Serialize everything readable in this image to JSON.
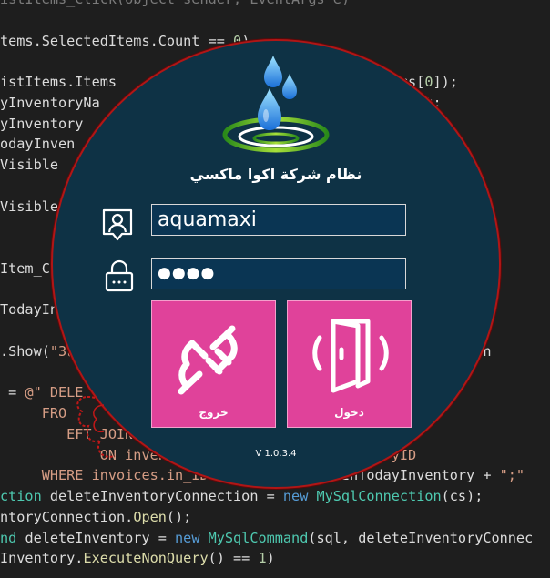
{
  "code_lines": [
    [
      {
        "t": "istItems_Click",
        "c": "tk-dim"
      },
      {
        "t": "(object sender, EventArgs e)",
        "c": "tk-dim"
      }
    ],
    [],
    [
      {
        "t": "tems.SelectedItems.Count == ",
        "c": "tk-id"
      },
      {
        "t": "0",
        "c": "tk-num"
      },
      {
        "t": ")",
        "c": "tk-id"
      }
    ],
    [],
    [
      {
        "t": "istItems.Items",
        "c": "tk-id"
      },
      {
        "t": "                              ",
        "c": "tk-id"
      },
      {
        "t": "dItems[",
        "c": "tk-id"
      },
      {
        "t": "0",
        "c": "tk-num"
      },
      {
        "t": "]);",
        "c": "tk-id"
      }
    ],
    [
      {
        "t": "yInventoryNa",
        "c": "tk-id"
      },
      {
        "t": "                                  ",
        "c": "tk-id"
      },
      {
        "t": "].Text;",
        "c": "tk-id"
      }
    ],
    [
      {
        "t": "yInventory",
        "c": "tk-id"
      },
      {
        "t": "                                    ",
        "c": "tk-id"
      },
      {
        "t": "();",
        "c": "tk-id"
      }
    ],
    [
      {
        "t": "odayInven",
        "c": "tk-id"
      }
    ],
    [
      {
        "t": "Visible",
        "c": "tk-id"
      }
    ],
    [],
    [
      {
        "t": "Visible",
        "c": "tk-id"
      }
    ],
    [],
    [],
    [
      {
        "t": "Item_Cl",
        "c": "tk-id"
      }
    ],
    [],
    [
      {
        "t": "TodayIn",
        "c": "tk-id"
      }
    ],
    [],
    [
      {
        "t": ".Show(",
        "c": "tk-id"
      },
      {
        "t": "\"ة3",
        "c": "tk-str"
      },
      {
        "t": "                                         ",
        "c": "tk-id"
      },
      {
        "t": "odayInven",
        "c": "tk-id"
      }
    ],
    [],
    [
      {
        "t": " = ",
        "c": "tk-id"
      },
      {
        "t": "@\" DELE",
        "c": "tk-str"
      }
    ],
    [
      {
        "t": "     FRO",
        "c": "tk-str"
      }
    ],
    [
      {
        "t": "        EFT JOIN",
        "c": "tk-str"
      }
    ],
    [
      {
        "t": "            ON inven",
        "c": "tk-str"
      },
      {
        "t": "                 ",
        "c": "tk-str"
      },
      {
        "t": "s.inventoryID",
        "c": "tk-str"
      }
    ],
    [
      {
        "t": "     WHERE invoices.in_ID=\"",
        "c": "tk-str"
      },
      {
        "t": "+ selectedItemInTodayInventory + ",
        "c": "tk-id"
      },
      {
        "t": "\";\"",
        "c": "tk-str"
      }
    ],
    [
      {
        "t": "ction ",
        "c": "tk-type"
      },
      {
        "t": "deleteInventoryConnection = ",
        "c": "tk-id"
      },
      {
        "t": "new ",
        "c": "tk-kw"
      },
      {
        "t": "MySqlConnection",
        "c": "tk-type"
      },
      {
        "t": "(cs);",
        "c": "tk-id"
      }
    ],
    [
      {
        "t": "ntoryConnection.",
        "c": "tk-id"
      },
      {
        "t": "Open",
        "c": "tk-fn"
      },
      {
        "t": "();",
        "c": "tk-id"
      }
    ],
    [
      {
        "t": "nd ",
        "c": "tk-type"
      },
      {
        "t": "deleteInventory = ",
        "c": "tk-id"
      },
      {
        "t": "new ",
        "c": "tk-kw"
      },
      {
        "t": "MySqlCommand",
        "c": "tk-type"
      },
      {
        "t": "(sql, deleteInventoryConnec",
        "c": "tk-id"
      }
    ],
    [
      {
        "t": "Inventory.",
        "c": "tk-id"
      },
      {
        "t": "ExecuteNonQuery",
        "c": "tk-fn"
      },
      {
        "t": "() == ",
        "c": "tk-id"
      },
      {
        "t": "1",
        "c": "tk-num"
      },
      {
        "t": ")",
        "c": "tk-id"
      }
    ]
  ],
  "login": {
    "title": "نظام شركة اكوا ماكسي",
    "username_value": "aquamaxi",
    "password_value": "●●●●",
    "exit_label": "خروج",
    "login_label": "دخول",
    "version": "V 1.0.3.4"
  },
  "icons": {
    "logo": "water-drops-logo-icon",
    "user": "user-badge-icon",
    "lock": "padlock-icon",
    "exit": "unplug-icon",
    "login": "door-icon"
  },
  "colors": {
    "editor_bg": "#1e1e1e",
    "circle_bg": "#0e3245",
    "circle_border": "#b01616",
    "input_bg": "#0a3553",
    "tile_pink": "#e0429a"
  }
}
